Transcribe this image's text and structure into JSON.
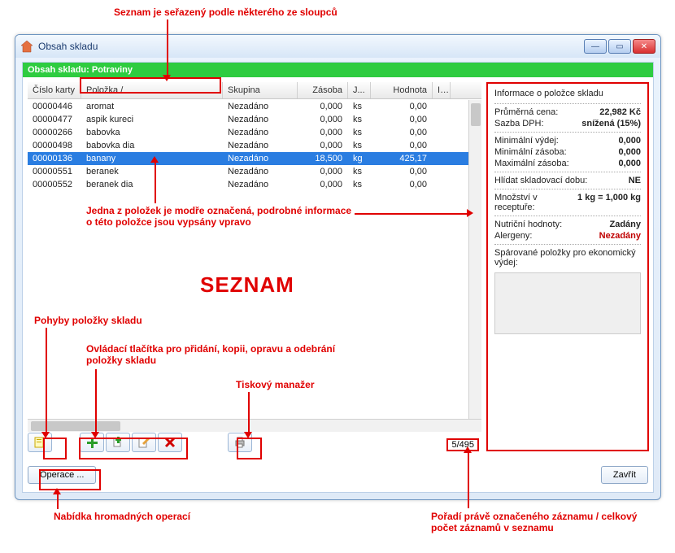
{
  "window": {
    "title": "Obsah skladu"
  },
  "greenbar": "Obsah skladu: Potraviny",
  "columns": {
    "card": "Číslo karty",
    "item": "Položka    /",
    "group": "Skupina",
    "stock": "Zásoba",
    "unit": "J...",
    "value": "Hodnota",
    "last": "I..."
  },
  "rows": [
    {
      "card": "00000446",
      "item": "aromat",
      "group": "Nezadáno",
      "stock": "0,000",
      "unit": "ks",
      "value": "0,00",
      "sel": false
    },
    {
      "card": "00000477",
      "item": "aspik kureci",
      "group": "Nezadáno",
      "stock": "0,000",
      "unit": "ks",
      "value": "0,00",
      "sel": false
    },
    {
      "card": "00000266",
      "item": "babovka",
      "group": "Nezadáno",
      "stock": "0,000",
      "unit": "ks",
      "value": "0,00",
      "sel": false
    },
    {
      "card": "00000498",
      "item": "babovka dia",
      "group": "Nezadáno",
      "stock": "0,000",
      "unit": "ks",
      "value": "0,00",
      "sel": false
    },
    {
      "card": "00000136",
      "item": "banany",
      "group": "Nezadáno",
      "stock": "18,500",
      "unit": "kg",
      "value": "425,17",
      "sel": true
    },
    {
      "card": "00000551",
      "item": "beranek",
      "group": "Nezadáno",
      "stock": "0,000",
      "unit": "ks",
      "value": "0,00",
      "sel": false
    },
    {
      "card": "00000552",
      "item": "beranek dia",
      "group": "Nezadáno",
      "stock": "0,000",
      "unit": "ks",
      "value": "0,00",
      "sel": false
    }
  ],
  "side": {
    "title": "Informace o položce skladu",
    "avg_price_label": "Průměrná cena:",
    "avg_price": "22,982 Kč",
    "vat_label": "Sazba DPH:",
    "vat": "snížená (15%)",
    "min_out_label": "Minimální výdej:",
    "min_out": "0,000",
    "min_stock_label": "Minimální zásoba:",
    "min_stock": "0,000",
    "max_stock_label": "Maximální zásoba:",
    "max_stock": "0,000",
    "watch_label": "Hlídat skladovací dobu:",
    "watch": "NE",
    "recipe_label": "Množství v receptuře:",
    "recipe": "1 kg = 1,000 kg",
    "nutri_label": "Nutriční hodnoty:",
    "nutri": "Zadány",
    "allerg_label": "Alergeny:",
    "allerg": "Nezadány",
    "paired_label": "Spárované položky pro ekonomický výdej:"
  },
  "counter": "5/495",
  "buttons": {
    "operations": "Operace ...",
    "close": "Zavřít"
  },
  "ann": {
    "sort": "Seznam je seřazený podle některého ze sloupců",
    "sel_info": "Jedna z položek je modře označená, podrobné informace o této položce jsou vypsány vpravo",
    "seznam": "SEZNAM",
    "pohyby": "Pohyby položky skladu",
    "ovladaci": "Ovládací tlačítka pro přidání, kopii, opravu a odebrání položky skladu",
    "tisk": "Tiskový manažer",
    "nabidka": "Nabídka hromadných operací",
    "poradi": "Pořadí právě označeného záznamu / celkový počet záznamů v seznamu"
  }
}
